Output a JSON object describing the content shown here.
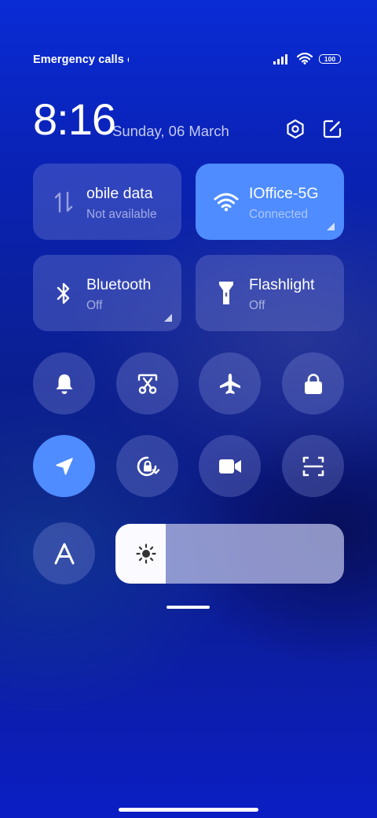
{
  "status_bar": {
    "carrier_text": "Emergency calls o",
    "battery": "100",
    "icons": [
      "signal-icon",
      "wifi-icon",
      "battery-icon"
    ]
  },
  "header": {
    "time": "8:16",
    "date": "Sunday, 06 March",
    "icons": [
      "settings-icon",
      "edit-icon"
    ]
  },
  "tiles": [
    {
      "id": "mobile-data",
      "title": "obile data",
      "subtitle": "Not available",
      "icon": "mobile-data-icon",
      "active": false
    },
    {
      "id": "wifi",
      "title": "IOffice-5G",
      "subtitle": "Connected",
      "icon": "wifi-icon",
      "active": true
    },
    {
      "id": "bluetooth",
      "title": "Bluetooth",
      "subtitle": "Off",
      "icon": "bluetooth-icon",
      "active": false
    },
    {
      "id": "flashlight",
      "title": "Flashlight",
      "subtitle": "Off",
      "icon": "flashlight-icon",
      "active": false
    }
  ],
  "toggles": [
    {
      "id": "ringer",
      "icon": "bell-icon",
      "active": false
    },
    {
      "id": "screenshot",
      "icon": "screenshot-icon",
      "active": false
    },
    {
      "id": "airplane",
      "icon": "airplane-icon",
      "active": false
    },
    {
      "id": "lock",
      "icon": "lock-icon",
      "active": false
    },
    {
      "id": "location",
      "icon": "location-arrow-icon",
      "active": true
    },
    {
      "id": "rotation-lock",
      "icon": "rotation-lock-icon",
      "active": false
    },
    {
      "id": "screen-record",
      "icon": "video-camera-icon",
      "active": false
    },
    {
      "id": "scanner",
      "icon": "scan-icon",
      "active": false
    },
    {
      "id": "reading-mode",
      "icon": "font-a-icon",
      "active": false
    }
  ],
  "brightness": {
    "level": 0.22,
    "icon": "sun-icon"
  },
  "colors": {
    "accent": "#4e8cff",
    "tile_dim": "rgba(140,150,220,0.30)"
  }
}
